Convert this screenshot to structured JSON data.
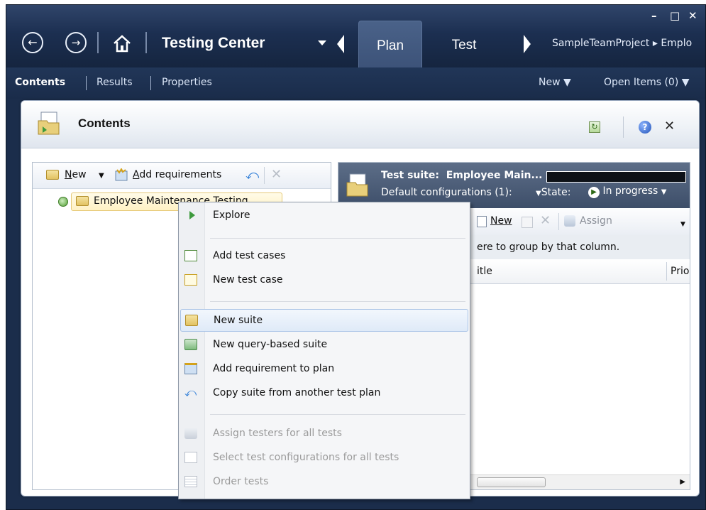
{
  "titlebar": {
    "back_icon": "back-arrow-icon",
    "forward_icon": "forward-arrow-icon",
    "home_icon": "home-icon",
    "app_title": "Testing Center",
    "tabs": [
      {
        "label": "Plan",
        "active": true
      },
      {
        "label": "Test",
        "active": false
      }
    ],
    "breadcrumb": "SampleTeamProject ▸ Emplo",
    "window_buttons": {
      "minimize": "–",
      "maximize": "□",
      "close": "✕"
    }
  },
  "subnav": {
    "items": [
      "Contents",
      "Results",
      "Properties"
    ],
    "new_label": "New",
    "open_items_label": "Open Items (0)"
  },
  "panel": {
    "title": "Contents",
    "refresh_icon": "refresh-icon",
    "help_icon": "help-icon",
    "close_icon": "close-icon"
  },
  "left_pane": {
    "toolbar": {
      "new_label": "New",
      "new_accesskey": "N",
      "new_rest": "ew",
      "add_requirements_label": "Add requirements",
      "add_req_accesskey": "A",
      "add_req_rest": "dd requirements"
    },
    "tree_item": "Employee Maintenance Testing"
  },
  "right_pane": {
    "suite_label": "Test suite:",
    "suite_name": "Employee Main...",
    "default_configurations": "Default configurations (1):",
    "state_label": "State:",
    "state_value": "In progress",
    "toolbar": {
      "new_label": "New",
      "assign_label": "Assign"
    },
    "group_hint": "ere to group by that column.",
    "columns": [
      "itle",
      "Prio"
    ]
  },
  "context_menu": {
    "items": [
      {
        "label": "Explore",
        "icon": "play-icon",
        "enabled": true
      },
      {
        "label": "Add test cases",
        "icon": "add-test-case-icon",
        "enabled": true
      },
      {
        "label": "New test case",
        "icon": "new-test-case-icon",
        "enabled": true
      },
      {
        "label": "New suite",
        "icon": "new-suite-icon",
        "enabled": true,
        "highlighted": true
      },
      {
        "label": "New query-based suite",
        "icon": "query-suite-icon",
        "enabled": true
      },
      {
        "label": "Add requirement to plan",
        "icon": "add-requirement-icon",
        "enabled": true
      },
      {
        "label": "Copy suite from another test plan",
        "icon": "copy-suite-icon",
        "enabled": true
      },
      {
        "label": "Assign testers for all tests",
        "icon": "assign-testers-icon",
        "enabled": false
      },
      {
        "label": "Select test configurations for all tests",
        "icon": "configurations-icon",
        "enabled": false
      },
      {
        "label": "Order tests",
        "icon": "order-tests-icon",
        "enabled": false
      }
    ]
  },
  "colors": {
    "accent": "#e9b434",
    "titlebar": "#1c2f51",
    "highlight": "#dfeaf8"
  }
}
